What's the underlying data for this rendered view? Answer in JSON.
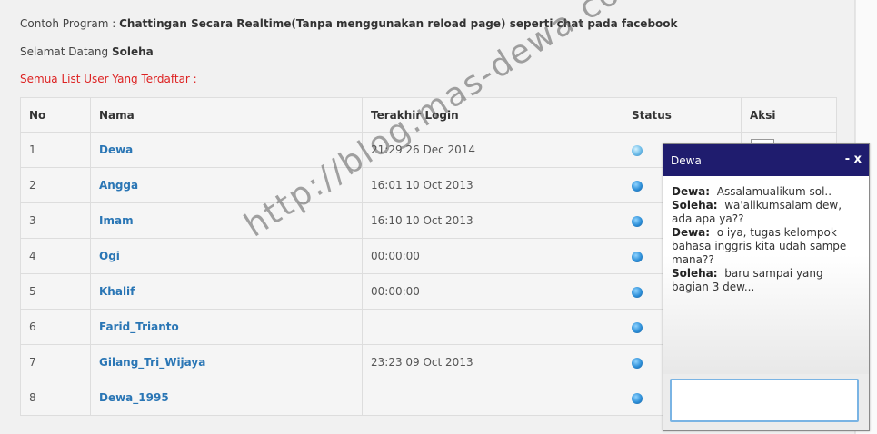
{
  "intro": {
    "program_label": "Contoh Program :",
    "program_title": "Chattingan Secara Realtime(Tanpa menggunakan reload page) seperti chat pada facebook",
    "welcome_label": "Selamat Datang",
    "welcome_user": "Soleha",
    "list_heading": "Semua List User Yang Terdaftar :"
  },
  "table": {
    "headers": [
      "No",
      "Nama",
      "Terakhir Login",
      "Status",
      "Aksi"
    ],
    "rows": [
      {
        "no": "1",
        "name": "Dewa",
        "login": "21:29 26 Dec 2014"
      },
      {
        "no": "2",
        "name": "Angga",
        "login": "16:01 10 Oct 2013"
      },
      {
        "no": "3",
        "name": "Imam",
        "login": "16:10 10 Oct 2013"
      },
      {
        "no": "4",
        "name": "Ogi",
        "login": "00:00:00"
      },
      {
        "no": "5",
        "name": "Khalif",
        "login": "00:00:00"
      },
      {
        "no": "6",
        "name": "Farid_Trianto",
        "login": ""
      },
      {
        "no": "7",
        "name": "Gilang_Tri_Wijaya",
        "login": "23:23 09 Oct 2013"
      },
      {
        "no": "8",
        "name": "Dewa_1995",
        "login": ""
      }
    ]
  },
  "chat": {
    "title": "Dewa",
    "controls": "- x",
    "messages": [
      {
        "sender": "Dewa:",
        "text": "Assalamualikum sol.."
      },
      {
        "sender": "Soleha:",
        "text": "wa'alikumsalam dew, ada apa ya??"
      },
      {
        "sender": "Dewa:",
        "text": "o iya, tugas kelompok bahasa inggris kita udah sampe mana??"
      },
      {
        "sender": "Soleha:",
        "text": "baru sampai yang bagian 3 dew..."
      }
    ],
    "input_value": ""
  },
  "watermark": "http://blog.mas-dewa.com"
}
